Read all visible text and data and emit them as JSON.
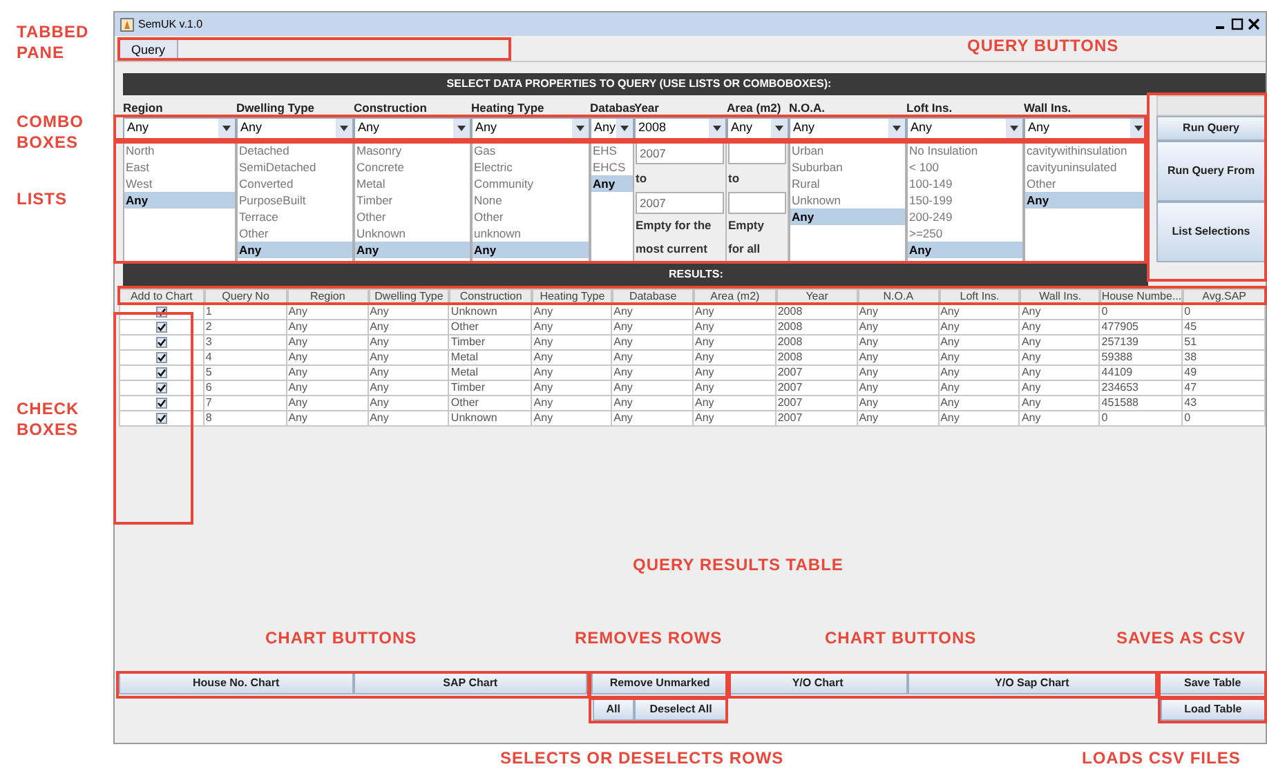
{
  "window": {
    "title": "SemUK v.1.0"
  },
  "tabs": [
    {
      "label": "Query",
      "selected": true
    }
  ],
  "query_panel": {
    "heading": "SELECT DATA PROPERTIES TO QUERY (USE LISTS OR COMBOBOXES):",
    "columns": [
      {
        "kind": "list",
        "label": "Region",
        "combo": "Any",
        "items": [
          {
            "label": "North",
            "selected": false
          },
          {
            "label": "East",
            "selected": false
          },
          {
            "label": "West",
            "selected": false
          },
          {
            "label": "Any",
            "selected": true
          }
        ]
      },
      {
        "kind": "list",
        "label": "Dwelling Type",
        "combo": "Any",
        "items": [
          {
            "label": "Detached",
            "selected": false
          },
          {
            "label": "SemiDetached",
            "selected": false
          },
          {
            "label": "Converted",
            "selected": false
          },
          {
            "label": "PurposeBuilt",
            "selected": false
          },
          {
            "label": "Terrace",
            "selected": false
          },
          {
            "label": "Other",
            "selected": false
          },
          {
            "label": "Any",
            "selected": true
          }
        ]
      },
      {
        "kind": "list",
        "label": "Construction",
        "combo": "Any",
        "items": [
          {
            "label": "Masonry",
            "selected": false
          },
          {
            "label": "Concrete",
            "selected": false
          },
          {
            "label": "Metal",
            "selected": false
          },
          {
            "label": "Timber",
            "selected": false
          },
          {
            "label": "Other",
            "selected": false
          },
          {
            "label": "Unknown",
            "selected": false
          },
          {
            "label": "Any",
            "selected": true
          }
        ]
      },
      {
        "kind": "list",
        "label": "Heating Type",
        "combo": "Any",
        "items": [
          {
            "label": "Gas",
            "selected": false
          },
          {
            "label": "Electric",
            "selected": false
          },
          {
            "label": "Community",
            "selected": false
          },
          {
            "label": "None",
            "selected": false
          },
          {
            "label": "Other",
            "selected": false
          },
          {
            "label": "unknown",
            "selected": false
          },
          {
            "label": "Any",
            "selected": true
          }
        ]
      },
      {
        "kind": "list",
        "label": "Databas",
        "combo": "Any",
        "items": [
          {
            "label": "EHS",
            "selected": false
          },
          {
            "label": "EHCS",
            "selected": false
          },
          {
            "label": "Any",
            "selected": true
          }
        ]
      },
      {
        "kind": "range",
        "label": "Year",
        "combo": "2008",
        "from": "2007",
        "to_label": "to",
        "to": "2007",
        "note": [
          "Empty for the",
          "most current"
        ]
      },
      {
        "kind": "range",
        "label": "Area (m2)",
        "combo": "Any",
        "to_label": "to",
        "note": [
          "Empty",
          "for all"
        ]
      },
      {
        "kind": "list",
        "label": "N.O.A.",
        "combo": "Any",
        "items": [
          {
            "label": "Urban",
            "selected": false
          },
          {
            "label": "Suburban",
            "selected": false
          },
          {
            "label": "Rural",
            "selected": false
          },
          {
            "label": "Unknown",
            "selected": false
          },
          {
            "label": "Any",
            "selected": true
          }
        ]
      },
      {
        "kind": "list",
        "label": "Loft Ins.",
        "combo": "Any",
        "items": [
          {
            "label": "No Insulation",
            "selected": false
          },
          {
            "label": "< 100",
            "selected": false
          },
          {
            "label": "100-149",
            "selected": false
          },
          {
            "label": "150-199",
            "selected": false
          },
          {
            "label": "200-249",
            "selected": false
          },
          {
            "label": ">=250",
            "selected": false
          },
          {
            "label": "Any",
            "selected": true
          }
        ]
      },
      {
        "kind": "list",
        "label": "Wall Ins.",
        "combo": "Any",
        "items": [
          {
            "label": "cavitywithinsulation",
            "selected": false
          },
          {
            "label": "cavityuninsulated",
            "selected": false
          },
          {
            "label": "Other",
            "selected": false
          },
          {
            "label": "Any",
            "selected": true
          }
        ]
      }
    ],
    "buttons": [
      "Run Query",
      "Run Query From",
      "List Selections"
    ]
  },
  "results": {
    "heading": "RESULTS:",
    "check_column": "Add to Chart",
    "columns": [
      "Query No",
      "Region",
      "Dwelling Type",
      "Construction",
      "Heating Type",
      "Database",
      "Area (m2)",
      "Year",
      "N.O.A",
      "Loft Ins.",
      "Wall Ins.",
      "House Numbe...",
      "Avg.SAP"
    ],
    "rows": [
      {
        "checked": true,
        "cells": [
          "1",
          "Any",
          "Any",
          "Unknown",
          "Any",
          "Any",
          "Any",
          "2008",
          "Any",
          "Any",
          "Any",
          "0",
          "0"
        ]
      },
      {
        "checked": true,
        "cells": [
          "2",
          "Any",
          "Any",
          "Other",
          "Any",
          "Any",
          "Any",
          "2008",
          "Any",
          "Any",
          "Any",
          "477905",
          "45"
        ]
      },
      {
        "checked": true,
        "cells": [
          "3",
          "Any",
          "Any",
          "Timber",
          "Any",
          "Any",
          "Any",
          "2008",
          "Any",
          "Any",
          "Any",
          "257139",
          "51"
        ]
      },
      {
        "checked": true,
        "cells": [
          "4",
          "Any",
          "Any",
          "Metal",
          "Any",
          "Any",
          "Any",
          "2008",
          "Any",
          "Any",
          "Any",
          "59388",
          "38"
        ]
      },
      {
        "checked": true,
        "cells": [
          "5",
          "Any",
          "Any",
          "Metal",
          "Any",
          "Any",
          "Any",
          "2007",
          "Any",
          "Any",
          "Any",
          "44109",
          "49"
        ]
      },
      {
        "checked": true,
        "cells": [
          "6",
          "Any",
          "Any",
          "Timber",
          "Any",
          "Any",
          "Any",
          "2007",
          "Any",
          "Any",
          "Any",
          "234653",
          "47"
        ]
      },
      {
        "checked": true,
        "cells": [
          "7",
          "Any",
          "Any",
          "Other",
          "Any",
          "Any",
          "Any",
          "2007",
          "Any",
          "Any",
          "Any",
          "451588",
          "43"
        ]
      },
      {
        "checked": true,
        "cells": [
          "8",
          "Any",
          "Any",
          "Unknown",
          "Any",
          "Any",
          "Any",
          "2007",
          "Any",
          "Any",
          "Any",
          "0",
          "0"
        ]
      }
    ]
  },
  "bottom_buttons": {
    "row_1": [
      "House No. Chart",
      "SAP Chart",
      "Remove Unmarked",
      "Y/O Chart",
      "Y/O Sap Chart",
      "Save Table"
    ],
    "row_2": [
      "All",
      "Deselect All",
      "Load Table"
    ]
  },
  "annotations": [
    "TABBED PANE",
    "COMBO BOXES",
    "LISTS",
    "CHECK BOXES",
    "QUERY BUTTONS",
    "QUERY RESULTS TABLE",
    "CHART BUTTONS",
    "REMOVES ROWS",
    "CHART BUTTONS",
    "SAVES AS CSV",
    "SELECTS OR DESELECTS ROWS",
    "LOADS CSV FILES"
  ]
}
